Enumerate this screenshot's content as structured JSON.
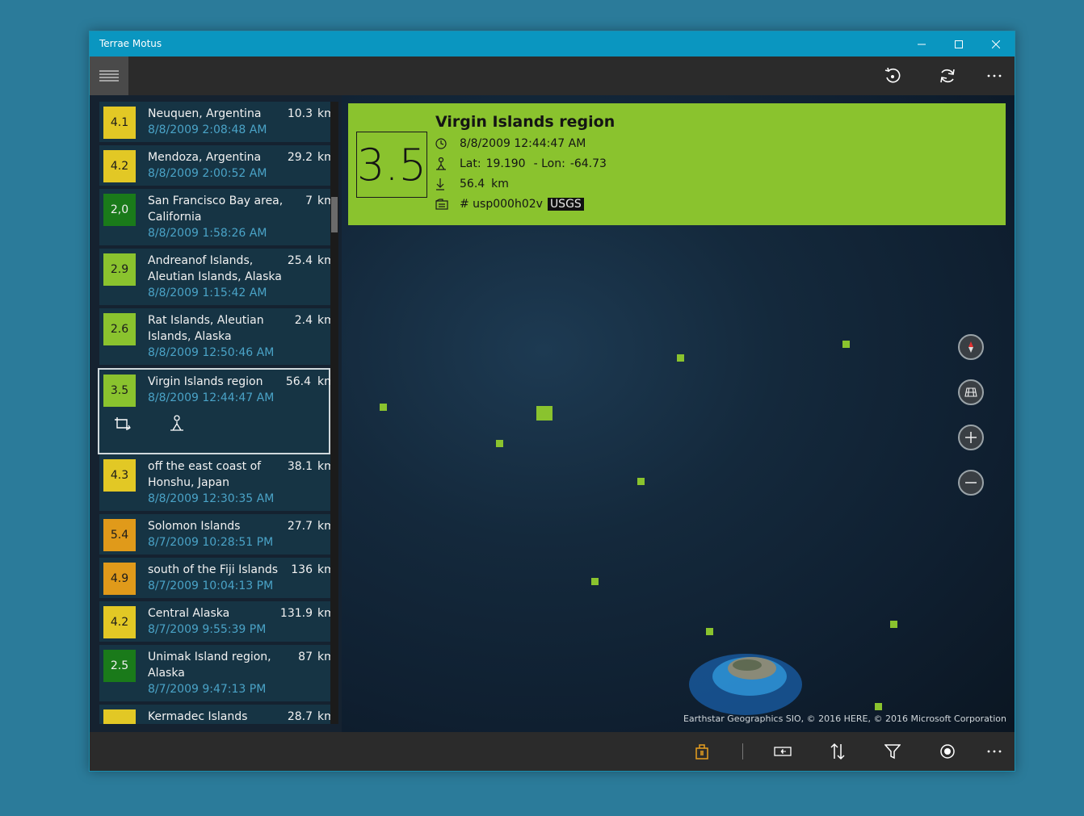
{
  "window": {
    "title": "Terrae Motus"
  },
  "colors": {
    "green_light": "#8ac32e",
    "green_dark": "#1a7a1a",
    "yellow": "#e2c825",
    "orange": "#e09a1a",
    "accent": "#0a96c0",
    "time_text": "#4aa3c7"
  },
  "list": {
    "unit": "km",
    "items": [
      {
        "mag": "4.1",
        "place": "Neuquen, Argentina",
        "time": "8/8/2009 2:08:48 AM",
        "depth": "10.3",
        "color": "yellow"
      },
      {
        "mag": "4.2",
        "place": "Mendoza, Argentina",
        "time": "8/8/2009 2:00:52 AM",
        "depth": "29.2",
        "color": "yellow"
      },
      {
        "mag": "2,0",
        "place": "San Francisco Bay area, California",
        "time": "8/8/2009 1:58:26 AM",
        "depth": "7",
        "color": "green_dark"
      },
      {
        "mag": "2.9",
        "place": "Andreanof Islands, Aleutian Islands, Alaska",
        "time": "8/8/2009 1:15:42 AM",
        "depth": "25.4",
        "color": "green_light"
      },
      {
        "mag": "2.6",
        "place": "Rat Islands, Aleutian Islands, Alaska",
        "time": "8/8/2009 12:50:46 AM",
        "depth": "2.4",
        "color": "green_light"
      },
      {
        "mag": "3.5",
        "place": "Virgin Islands region",
        "time": "8/8/2009 12:44:47 AM",
        "depth": "56.4",
        "color": "green_light"
      },
      {
        "mag": "4.3",
        "place": "off the east coast of Honshu, Japan",
        "time": "8/8/2009 12:30:35 AM",
        "depth": "38.1",
        "color": "yellow"
      },
      {
        "mag": "5.4",
        "place": "Solomon Islands",
        "time": "8/7/2009 10:28:51 PM",
        "depth": "27.7",
        "color": "orange"
      },
      {
        "mag": "4.9",
        "place": "south of the Fiji Islands",
        "time": "8/7/2009 10:04:13 PM",
        "depth": "136",
        "color": "orange"
      },
      {
        "mag": "4.2",
        "place": "Central Alaska",
        "time": "8/7/2009 9:55:39 PM",
        "depth": "131.9",
        "color": "yellow"
      },
      {
        "mag": "2.5",
        "place": "Unimak Island region, Alaska",
        "time": "8/7/2009 9:47:13 PM",
        "depth": "87",
        "color": "green_dark"
      },
      {
        "mag": "",
        "place": "Kermadec Islands",
        "time": "",
        "depth": "28.7",
        "color": "yellow"
      }
    ]
  },
  "detail": {
    "magnitude": "3.5",
    "title": "Virgin Islands region",
    "time": "8/8/2009 12:44:47 AM",
    "lat_label": "Lat:",
    "lat": "19.190",
    "lon_label": "- Lon:",
    "lon": "-64.73",
    "depth": "56.4",
    "depth_unit": "km",
    "id": "# usp000h02v",
    "source": "USGS"
  },
  "map": {
    "credits": "Earthstar Geographics  SIO, © 2016 HERE, © 2016 Microsoft Corporation"
  },
  "icons": {
    "top": [
      "history-icon",
      "refresh-icon",
      "more-icon"
    ],
    "bottom": [
      "bag-icon",
      "panel-icon",
      "sort-icon",
      "filter-icon",
      "record-icon",
      "more-icon"
    ]
  }
}
